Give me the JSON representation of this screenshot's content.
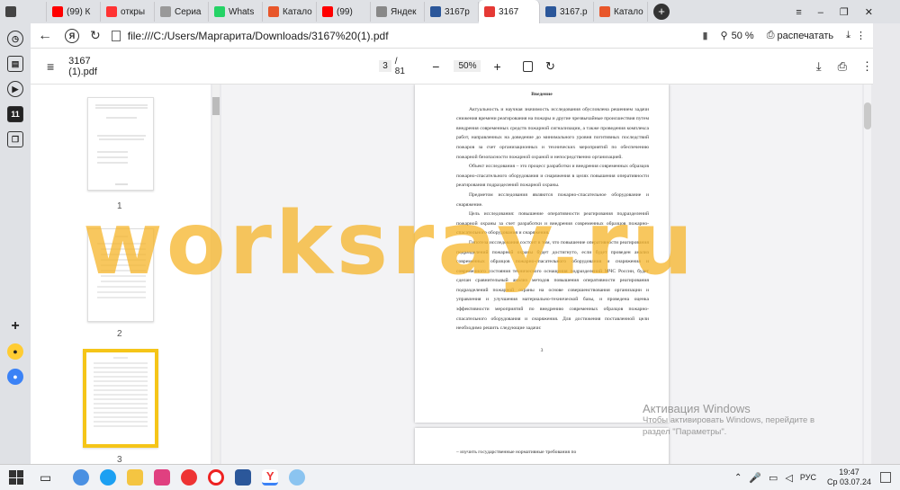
{
  "tabs": [
    {
      "label": "",
      "icon": "speaker-icon",
      "color": "#444"
    },
    {
      "label": "(99) К",
      "icon": "youtube-icon",
      "color": "#ff0000"
    },
    {
      "label": "откры",
      "icon": "yandex-icon",
      "color": "#ff3333"
    },
    {
      "label": "Сериа",
      "icon": "video-icon",
      "color": "#999"
    },
    {
      "label": "Whats",
      "icon": "whatsapp-icon",
      "color": "#25d366"
    },
    {
      "label": "Катало",
      "icon": "store-icon",
      "color": "#e8562a"
    },
    {
      "label": "(99)",
      "icon": "youtube-icon",
      "color": "#ff0000"
    },
    {
      "label": "Яндек",
      "icon": "yandex-icon",
      "color": "#888"
    },
    {
      "label": "3167р",
      "icon": "doc-icon",
      "color": "#2b579a"
    },
    {
      "label": "3167",
      "icon": "pdf-icon",
      "color": "#e53935",
      "active": true
    },
    {
      "label": "3167.р",
      "icon": "doc-icon",
      "color": "#2b579a"
    },
    {
      "label": "Катало",
      "icon": "store-icon",
      "color": "#e8562a"
    }
  ],
  "addressbar": {
    "url": "file:///C:/Users/Маргарита/Downloads/3167%20(1).pdf",
    "zoom": "50 %",
    "print": "распечатать"
  },
  "pdf": {
    "filename": "3167 (1).pdf",
    "page": "3",
    "total": "/ 81",
    "zoom": "50%"
  },
  "thumbs": [
    {
      "n": "1"
    },
    {
      "n": "2"
    },
    {
      "n": "3"
    }
  ],
  "doc": {
    "heading": "Введение",
    "paragraphs": [
      "Актуальность и научная значимость исследования обусловлена решением задачи снижения времени реагирования на пожары и другие чрезвычайные происшествия путем внедрения современных средств пожарной сигнализации, а также проведения комплекса работ, направленных на доведение до минимального уровня погитивных последствий пожаров за счет организационных и технических мероприятий по обеспечению пожарной безопасности пожарной охраной и непосредственно организацией.",
      "Объект исследования – это процесс разработки и внедрения современных образцов пожарно-спасательного оборудования и снаряжения в целях повышения оперативности реагирования подразделений пожарной охраны.",
      "Предметом исследования являются пожарно-спасательное оборудование и снаряжение.",
      "Цель исследования: повышение оперативности реагирования подразделений пожарной охраны за счет разработки и внедрения современных образцов пожарно-спасательного оборудования и снаряжения.",
      "Гипотеза исследования состоит в том, что повышение оперативности реагирования подразделений пожарной охраны будет достигнуто, если будет проведен анализ современных образцов пожарно-спасательного оборудования и снаряжения и современного состояния технического оснащения подразделений МЧС России, будет сделан сравнительный анализ методов повышения оперативности реагирования подразделений пожарной охраны на основе совершенствования организации и управления и улучшения материально-технической базы, и проведена оценка эффективности мероприятий по внедрению современных образцов пожарно-спасательного оборудования и снаряжения. Для достижения поставленной цели необходимо решить следующие задачи:"
    ],
    "pagenum": "3",
    "next_item": "– изучить государственные нормативные требования по"
  },
  "watermark": "worksray.ru",
  "windows_activation": {
    "title": "Активация Windows",
    "line1": "Чтобы активировать Windows, перейдите в",
    "line2": "раздел \"Параметры\"."
  },
  "taskbar": {
    "lang": "РУС",
    "time": "19:47",
    "date": "Ср 03.07.24"
  }
}
